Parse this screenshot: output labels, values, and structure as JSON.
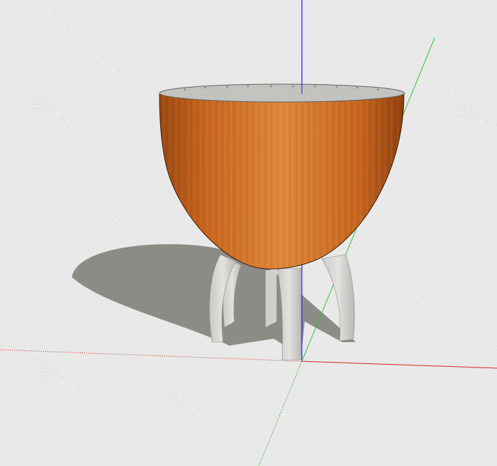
{
  "scene": {
    "name": "SketchUp viewport - wooden bowl stool model",
    "background_color": "#ececec",
    "axis_colors": {
      "blue_axis": "#2a2aff",
      "green_axis": "#29c42f",
      "red_axis": "#d62020"
    },
    "object": {
      "bowl_color": "#c8651f",
      "bowl_highlight": "#e08a3c",
      "bowl_shadow": "#8e3f10",
      "rim_color": "#c4c4c0",
      "legs_color": "#d5d5d2",
      "ground_shadow_color": "#7e7e78"
    }
  },
  "watermarks": [
    "http://www.yzfy.com",
    "云艺素材",
    "http://www.yzfy.com",
    "云艺素材",
    "http://www.yzfy.com",
    "云艺素材",
    "http://www.yzfy.com",
    "云艺素材"
  ]
}
